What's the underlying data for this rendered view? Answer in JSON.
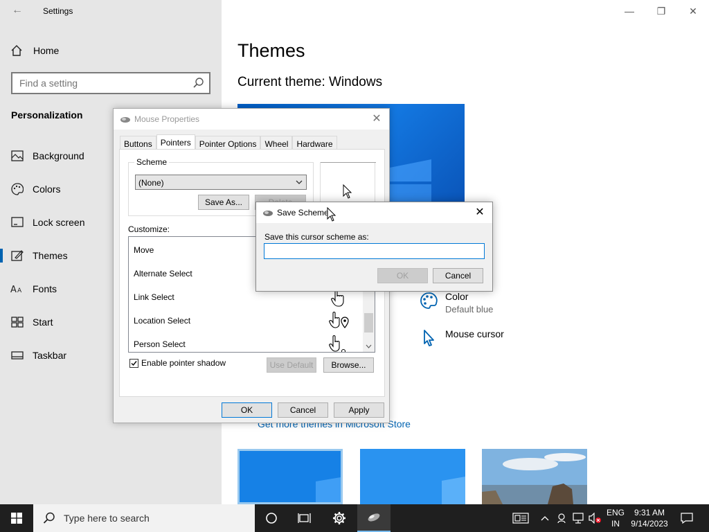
{
  "settings": {
    "window_title": "Settings",
    "home_label": "Home",
    "search_placeholder": "Find a setting",
    "section_label": "Personalization",
    "nav": [
      {
        "label": "Background",
        "icon": "picture-icon"
      },
      {
        "label": "Colors",
        "icon": "palette-icon"
      },
      {
        "label": "Lock screen",
        "icon": "lock-screen-icon"
      },
      {
        "label": "Themes",
        "icon": "themes-icon",
        "active": true
      },
      {
        "label": "Fonts",
        "icon": "fonts-icon"
      },
      {
        "label": "Start",
        "icon": "start-icon"
      },
      {
        "label": "Taskbar",
        "icon": "taskbar-icon"
      }
    ],
    "page_title": "Themes",
    "current_theme": "Current theme: Windows",
    "options": {
      "color_title": "Color",
      "color_sub": "Default blue",
      "mouse_cursor": "Mouse cursor"
    },
    "store_link": "Get more themes in Microsoft Store"
  },
  "mouse_properties": {
    "title": "Mouse Properties",
    "tabs": [
      "Buttons",
      "Pointers",
      "Pointer Options",
      "Wheel",
      "Hardware"
    ],
    "active_tab": "Pointers",
    "scheme_label": "Scheme",
    "scheme_value": "(None)",
    "save_as": "Save As...",
    "delete": "Delete",
    "customize_label": "Customize:",
    "cursor_rows": [
      "Move",
      "Alternate Select",
      "Link Select",
      "Location Select",
      "Person Select"
    ],
    "enable_shadow": "Enable pointer shadow",
    "use_default": "Use Default",
    "browse": "Browse...",
    "ok": "OK",
    "cancel": "Cancel",
    "apply": "Apply"
  },
  "save_scheme": {
    "title": "Save Scheme",
    "prompt": "Save this cursor scheme as:",
    "input_value": "",
    "ok": "OK",
    "cancel": "Cancel"
  },
  "taskbar": {
    "search_placeholder": "Type here to search",
    "lang_top": "ENG",
    "lang_bottom": "IN",
    "time": "9:31 AM",
    "date": "9/14/2023"
  },
  "colors": {
    "accent": "#0063b1",
    "taskbar": "#1f1f1f",
    "sidebar": "#e6e6e6"
  }
}
